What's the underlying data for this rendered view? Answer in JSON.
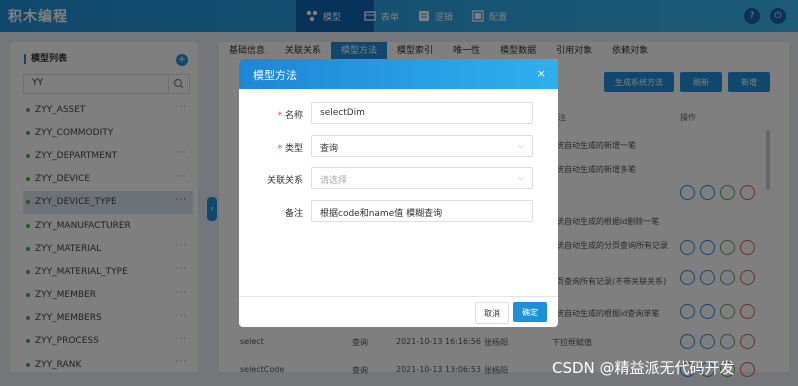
{
  "app": {
    "title": "积木编程"
  },
  "topnav": [
    {
      "label": "模型",
      "active": true
    },
    {
      "label": "表单",
      "active": false
    },
    {
      "label": "逻辑",
      "active": false
    },
    {
      "label": "配置",
      "active": false
    }
  ],
  "header_icons": [
    "help-icon",
    "power-icon"
  ],
  "sidebar": {
    "title": "模型列表",
    "search_value": "YY",
    "items": [
      {
        "label": "ZYY_ASSET"
      },
      {
        "label": "ZYY_COMMODITY"
      },
      {
        "label": "ZYY_DEPARTMENT"
      },
      {
        "label": "ZYY_DEVICE"
      },
      {
        "label": "ZYY_DEVICE_TYPE",
        "selected": true
      },
      {
        "label": "ZYY_MANUFACTURER"
      },
      {
        "label": "ZYY_MATERIAL"
      },
      {
        "label": "ZYY_MATERIAL_TYPE"
      },
      {
        "label": "ZYY_MEMBER"
      },
      {
        "label": "ZYY_MEMBERS"
      },
      {
        "label": "ZYY_PROCESS"
      },
      {
        "label": "ZYY_RANK"
      }
    ],
    "more_label": "···"
  },
  "tabs": [
    {
      "label": "基础信息"
    },
    {
      "label": "关联关系"
    },
    {
      "label": "模型方法",
      "active": true
    },
    {
      "label": "模型索引"
    },
    {
      "label": "唯一性"
    },
    {
      "label": "模型数据"
    },
    {
      "label": "引用对象"
    },
    {
      "label": "依赖对象"
    }
  ],
  "toolbar": {
    "generate_label": "生成系统方法",
    "refresh_label": "刷新",
    "add_label": "新增"
  },
  "table": {
    "headers": {
      "remark": "备注",
      "ops": "操作"
    },
    "rows": [
      {
        "remark": "系统自动生成的新增一笔"
      },
      {
        "remark": "系统自动生成的新增多笔"
      },
      {
        "remark": "系统自动生成的根据id删除一笔"
      },
      {
        "remark": "系统自动生成的分页查询所有记录"
      },
      {
        "remark": "分页查询所有记录(不带关联关系)"
      },
      {
        "remark": "系统自动生成的根据id查询单笔"
      },
      {
        "name": "select",
        "type": "查询",
        "date": "2021-10-13 16:16:56",
        "user": "张杨阳",
        "remark": "下拉框赋值"
      },
      {
        "name": "selectCode",
        "type": "查询",
        "date": "2021-10-13 13:06:53",
        "user": "张杨阳",
        "remark": "..."
      }
    ]
  },
  "dialog": {
    "title": "模型方法",
    "close": "×",
    "fields": {
      "name": {
        "label": "名称",
        "value": "selectDim",
        "required": true
      },
      "type": {
        "label": "类型",
        "value": "查询",
        "required": true
      },
      "relation": {
        "label": "关联关系",
        "placeholder": "请选择",
        "required": false
      },
      "remark": {
        "label": "备注",
        "value": "根据code和name值 模糊查询",
        "required": false
      }
    },
    "cancel_label": "取消",
    "confirm_label": "确定"
  },
  "watermark": "CSDN @精益派无代码开发",
  "colors": {
    "primary": "#1f90d8",
    "topbar": "#2aa3e6",
    "active_nav": "#0f64b4",
    "dot": "#49b04c"
  }
}
